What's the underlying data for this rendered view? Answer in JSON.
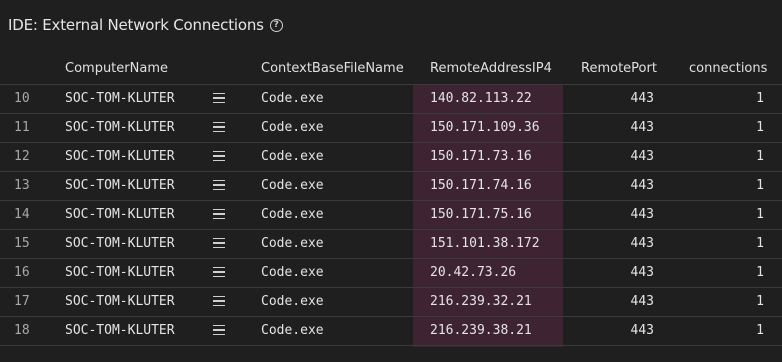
{
  "panel": {
    "title": "IDE: External Network Connections",
    "help_icon": "question-circle-icon"
  },
  "table": {
    "columns": [
      "ComputerName",
      "ContextBaseFileName",
      "RemoteAddressIP4",
      "RemotePort",
      "connections"
    ],
    "highlight_color": "#3e2433",
    "rows": [
      {
        "n": "10",
        "computer": "SOC-TOM-KLUTER",
        "file": "Code.exe",
        "ip": "140.82.113.22",
        "port": "443",
        "connections": "1"
      },
      {
        "n": "11",
        "computer": "SOC-TOM-KLUTER",
        "file": "Code.exe",
        "ip": "150.171.109.36",
        "port": "443",
        "connections": "1"
      },
      {
        "n": "12",
        "computer": "SOC-TOM-KLUTER",
        "file": "Code.exe",
        "ip": "150.171.73.16",
        "port": "443",
        "connections": "1"
      },
      {
        "n": "13",
        "computer": "SOC-TOM-KLUTER",
        "file": "Code.exe",
        "ip": "150.171.74.16",
        "port": "443",
        "connections": "1"
      },
      {
        "n": "14",
        "computer": "SOC-TOM-KLUTER",
        "file": "Code.exe",
        "ip": "150.171.75.16",
        "port": "443",
        "connections": "1"
      },
      {
        "n": "15",
        "computer": "SOC-TOM-KLUTER",
        "file": "Code.exe",
        "ip": "151.101.38.172",
        "port": "443",
        "connections": "1"
      },
      {
        "n": "16",
        "computer": "SOC-TOM-KLUTER",
        "file": "Code.exe",
        "ip": "20.42.73.26",
        "port": "443",
        "connections": "1"
      },
      {
        "n": "17",
        "computer": "SOC-TOM-KLUTER",
        "file": "Code.exe",
        "ip": "216.239.32.21",
        "port": "443",
        "connections": "1"
      },
      {
        "n": "18",
        "computer": "SOC-TOM-KLUTER",
        "file": "Code.exe",
        "ip": "216.239.38.21",
        "port": "443",
        "connections": "1"
      }
    ]
  }
}
